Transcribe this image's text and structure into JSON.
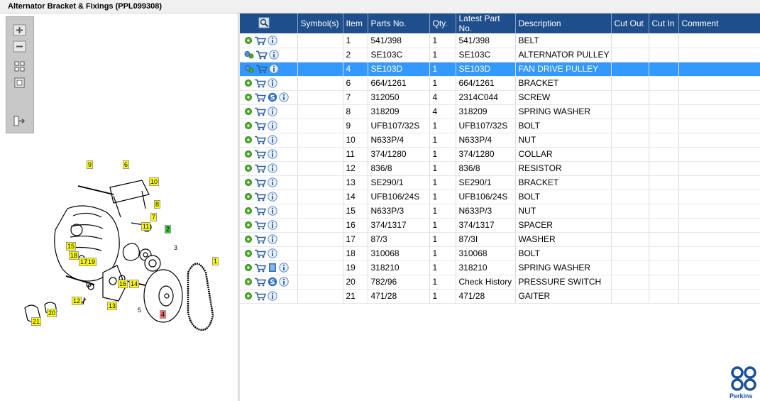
{
  "window": {
    "title": "Alternator Bracket & Fixings (PPL099308)"
  },
  "zoom_tools": [
    {
      "name": "zoom-in-icon"
    },
    {
      "name": "zoom-out-icon"
    },
    {
      "name": "fit-view-icon"
    },
    {
      "name": "actual-size-icon"
    },
    {
      "name": "export-icon"
    }
  ],
  "diagram": {
    "callouts": [
      "9",
      "6",
      "10",
      "8",
      "7",
      "11",
      "2",
      "3",
      "15",
      "18",
      "17",
      "19",
      "16",
      "14",
      "13",
      "4",
      "5",
      "1",
      "12",
      "20",
      "21"
    ]
  },
  "table": {
    "headers": [
      "",
      "Symbol(s)",
      "Item",
      "Parts No.",
      "Qty.",
      "Latest Part No.",
      "Description",
      "Cut Out",
      "Cut In",
      "Comment"
    ],
    "rows": [
      {
        "icons": [
          "gear",
          "cart",
          "info"
        ],
        "item": "1",
        "part": "541/398",
        "qty": "1",
        "latest": "541/398",
        "desc": "BELT"
      },
      {
        "icons": [
          "gears",
          "cart",
          "info"
        ],
        "item": "2",
        "part": "SE103C",
        "qty": "1",
        "latest": "SE103C",
        "desc": "ALTERNATOR PULLEY"
      },
      {
        "icons": [
          "gear-arrow",
          "cart",
          "info"
        ],
        "item": "4",
        "part": "SE103D",
        "qty": "1",
        "latest": "SE103D",
        "desc": "FAN DRIVE PULLEY",
        "selected": true
      },
      {
        "icons": [
          "gear",
          "cart",
          "info"
        ],
        "item": "6",
        "part": "664/1261",
        "qty": "1",
        "latest": "664/1261",
        "desc": "BRACKET"
      },
      {
        "icons": [
          "gear",
          "cart",
          "service",
          "info"
        ],
        "item": "7",
        "part": "312050",
        "qty": "4",
        "latest": "2314C044",
        "desc": "SCREW"
      },
      {
        "icons": [
          "gear",
          "cart",
          "info"
        ],
        "item": "8",
        "part": "318209",
        "qty": "4",
        "latest": "318209",
        "desc": "SPRING WASHER"
      },
      {
        "icons": [
          "gear",
          "cart",
          "info"
        ],
        "item": "9",
        "part": "UFB107/32S",
        "qty": "1",
        "latest": "UFB107/32S",
        "desc": "BOLT"
      },
      {
        "icons": [
          "gear",
          "cart",
          "info"
        ],
        "item": "10",
        "part": "N633P/4",
        "qty": "1",
        "latest": "N633P/4",
        "desc": "NUT"
      },
      {
        "icons": [
          "gear",
          "cart",
          "info"
        ],
        "item": "11",
        "part": "374/1280",
        "qty": "1",
        "latest": "374/1280",
        "desc": "COLLAR"
      },
      {
        "icons": [
          "gear",
          "cart",
          "info"
        ],
        "item": "12",
        "part": "836/8",
        "qty": "1",
        "latest": "836/8",
        "desc": "RESISTOR"
      },
      {
        "icons": [
          "gear",
          "cart",
          "info"
        ],
        "item": "13",
        "part": "SE290/1",
        "qty": "1",
        "latest": "SE290/1",
        "desc": "BRACKET"
      },
      {
        "icons": [
          "gear",
          "cart",
          "info"
        ],
        "item": "14",
        "part": "UFB106/24S",
        "qty": "1",
        "latest": "UFB106/24S",
        "desc": "BOLT"
      },
      {
        "icons": [
          "gear",
          "cart",
          "info"
        ],
        "item": "15",
        "part": "N633P/3",
        "qty": "1",
        "latest": "N633P/3",
        "desc": "NUT"
      },
      {
        "icons": [
          "gear",
          "cart",
          "info"
        ],
        "item": "16",
        "part": "374/1317",
        "qty": "1",
        "latest": "374/1317",
        "desc": "SPACER"
      },
      {
        "icons": [
          "gear",
          "cart",
          "info"
        ],
        "item": "17",
        "part": "87/3",
        "qty": "1",
        "latest": "87/3I",
        "desc": "WASHER"
      },
      {
        "icons": [
          "gear",
          "cart",
          "info"
        ],
        "item": "18",
        "part": "310068",
        "qty": "1",
        "latest": "310068",
        "desc": "BOLT"
      },
      {
        "icons": [
          "gear",
          "cart",
          "book",
          "info"
        ],
        "item": "19",
        "part": "318210",
        "qty": "1",
        "latest": "318210",
        "desc": "SPRING WASHER"
      },
      {
        "icons": [
          "gear",
          "cart",
          "service",
          "info"
        ],
        "item": "20",
        "part": "782/96",
        "qty": "1",
        "latest": "Check History",
        "desc": "PRESSURE SWITCH"
      },
      {
        "icons": [
          "gear",
          "cart",
          "info"
        ],
        "item": "21",
        "part": "471/28",
        "qty": "1",
        "latest": "471/28",
        "desc": "GAITER"
      }
    ]
  },
  "brand": {
    "name": "Perkins",
    "accent": "#1f4e8c",
    "selected_row": "#3399ff",
    "callout": "#ffff00"
  }
}
